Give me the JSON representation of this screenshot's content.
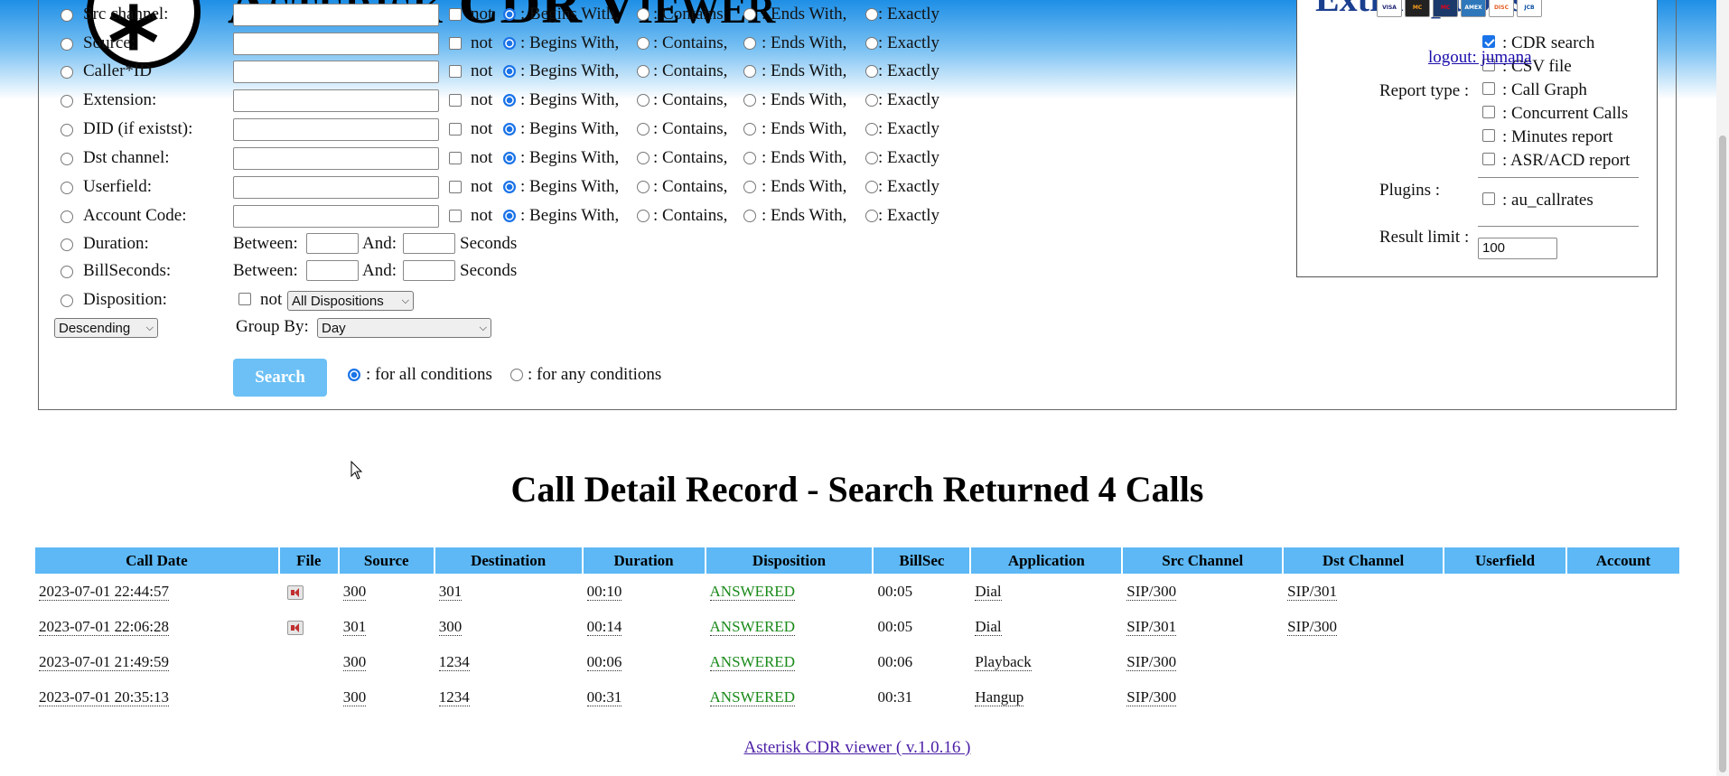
{
  "app": {
    "title": "Asterisk CDR Viewer"
  },
  "filters": [
    {
      "label": "Src channel:",
      "not": "not"
    },
    {
      "label": "Source:",
      "not": "not"
    },
    {
      "label": "Caller*ID",
      "not": "not"
    },
    {
      "label": "Extension:",
      "not": "not"
    },
    {
      "label": "DID (if existst):",
      "not": "not"
    },
    {
      "label": "Dst channel:",
      "not": "not"
    },
    {
      "label": "Userfield:",
      "not": "not"
    },
    {
      "label": "Account Code:",
      "not": "not"
    }
  ],
  "match_options": [
    ": Begins With,",
    ": Contains,",
    ": Ends With,",
    ": Exactly"
  ],
  "duration": {
    "label": "Duration:",
    "between": "Between:",
    "and": "And:",
    "unit": "Seconds"
  },
  "billseconds": {
    "label": "BillSeconds:",
    "between": "Between:",
    "and": "And:",
    "unit": "Seconds"
  },
  "disposition": {
    "label": "Disposition:",
    "not": "not",
    "selected": "All Dispositions"
  },
  "sort": {
    "selected": "Descending"
  },
  "group_by": {
    "label": "Group By:",
    "selected": "Day"
  },
  "search": {
    "button": "Search",
    "all_conditions": ": for all conditions",
    "any_conditions": ": for any conditions"
  },
  "options_box": {
    "title": "Extra options",
    "logout": "logout: jumana",
    "report_type_label": "Report type :",
    "report_types": [
      {
        "label": ": CDR search",
        "checked": true
      },
      {
        "label": ": CSV file",
        "checked": false
      },
      {
        "label": ": Call Graph",
        "checked": false
      },
      {
        "label": ": Concurrent Calls",
        "checked": false
      },
      {
        "label": ": Minutes report",
        "checked": false
      },
      {
        "label": ": ASR/ACD report",
        "checked": false
      }
    ],
    "plugins_label": "Plugins :",
    "plugins": [
      {
        "label": ": au_callrates",
        "checked": false
      }
    ],
    "result_limit_label": "Result limit :",
    "result_limit_value": "100",
    "cards": [
      "VISA",
      "MC",
      "MC",
      "AMEX",
      "DISC",
      "JCB"
    ]
  },
  "results": {
    "heading": "Call Detail Record - Search Returned 4 Calls",
    "columns": [
      "Call Date",
      "File",
      "Source",
      "Destination",
      "Duration",
      "Disposition",
      "BillSec",
      "Application",
      "Src Channel",
      "Dst Channel",
      "Userfield",
      "Account"
    ],
    "rows": [
      {
        "call_date": "2023-07-01 22:44:57",
        "file": true,
        "source": "300",
        "destination": "301",
        "duration": "00:10",
        "disposition": "ANSWERED",
        "billsec": "00:05",
        "application": "Dial",
        "src_channel": "SIP/300",
        "dst_channel": "SIP/301",
        "userfield": "",
        "account": ""
      },
      {
        "call_date": "2023-07-01 22:06:28",
        "file": true,
        "source": "301",
        "destination": "300",
        "duration": "00:14",
        "disposition": "ANSWERED",
        "billsec": "00:05",
        "application": "Dial",
        "src_channel": "SIP/301",
        "dst_channel": "SIP/300",
        "userfield": "",
        "account": ""
      },
      {
        "call_date": "2023-07-01 21:49:59",
        "file": false,
        "source": "300",
        "destination": "1234",
        "duration": "00:06",
        "disposition": "ANSWERED",
        "billsec": "00:06",
        "application": "Playback",
        "src_channel": "SIP/300",
        "dst_channel": "",
        "userfield": "",
        "account": ""
      },
      {
        "call_date": "2023-07-01 20:35:13",
        "file": false,
        "source": "300",
        "destination": "1234",
        "duration": "00:31",
        "disposition": "ANSWERED",
        "billsec": "00:31",
        "application": "Hangup",
        "src_channel": "SIP/300",
        "dst_channel": "",
        "userfield": "",
        "account": ""
      }
    ]
  },
  "footer": {
    "link": "Asterisk CDR viewer ( v.1.0.16 )"
  },
  "colors": {
    "header_blue": "#1e8fe6",
    "table_header": "#5db8f5",
    "answered_green": "#1a8a1a",
    "search_button": "#6cc0f5",
    "link": "#1a0dab"
  }
}
